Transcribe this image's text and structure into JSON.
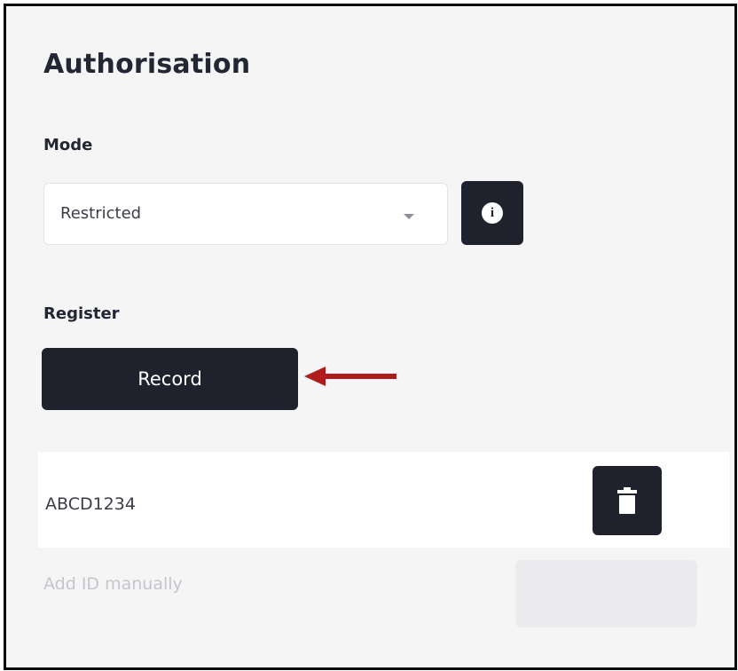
{
  "panel": {
    "title": "Authorisation",
    "mode_label": "Mode",
    "mode_value": "Restricted",
    "register_label": "Register",
    "record_label": "Record",
    "registered_ids": [
      "ABCD1234"
    ],
    "manual_placeholder": "Add ID manually"
  },
  "icons": {
    "info": "info-icon",
    "dropdown": "chevron-down-icon",
    "delete": "trash-icon",
    "annotation": "arrow-left-icon"
  },
  "colors": {
    "dark_button": "#1f222c",
    "annotation_arrow": "#b01c1c",
    "background": "#f5f5f6"
  }
}
